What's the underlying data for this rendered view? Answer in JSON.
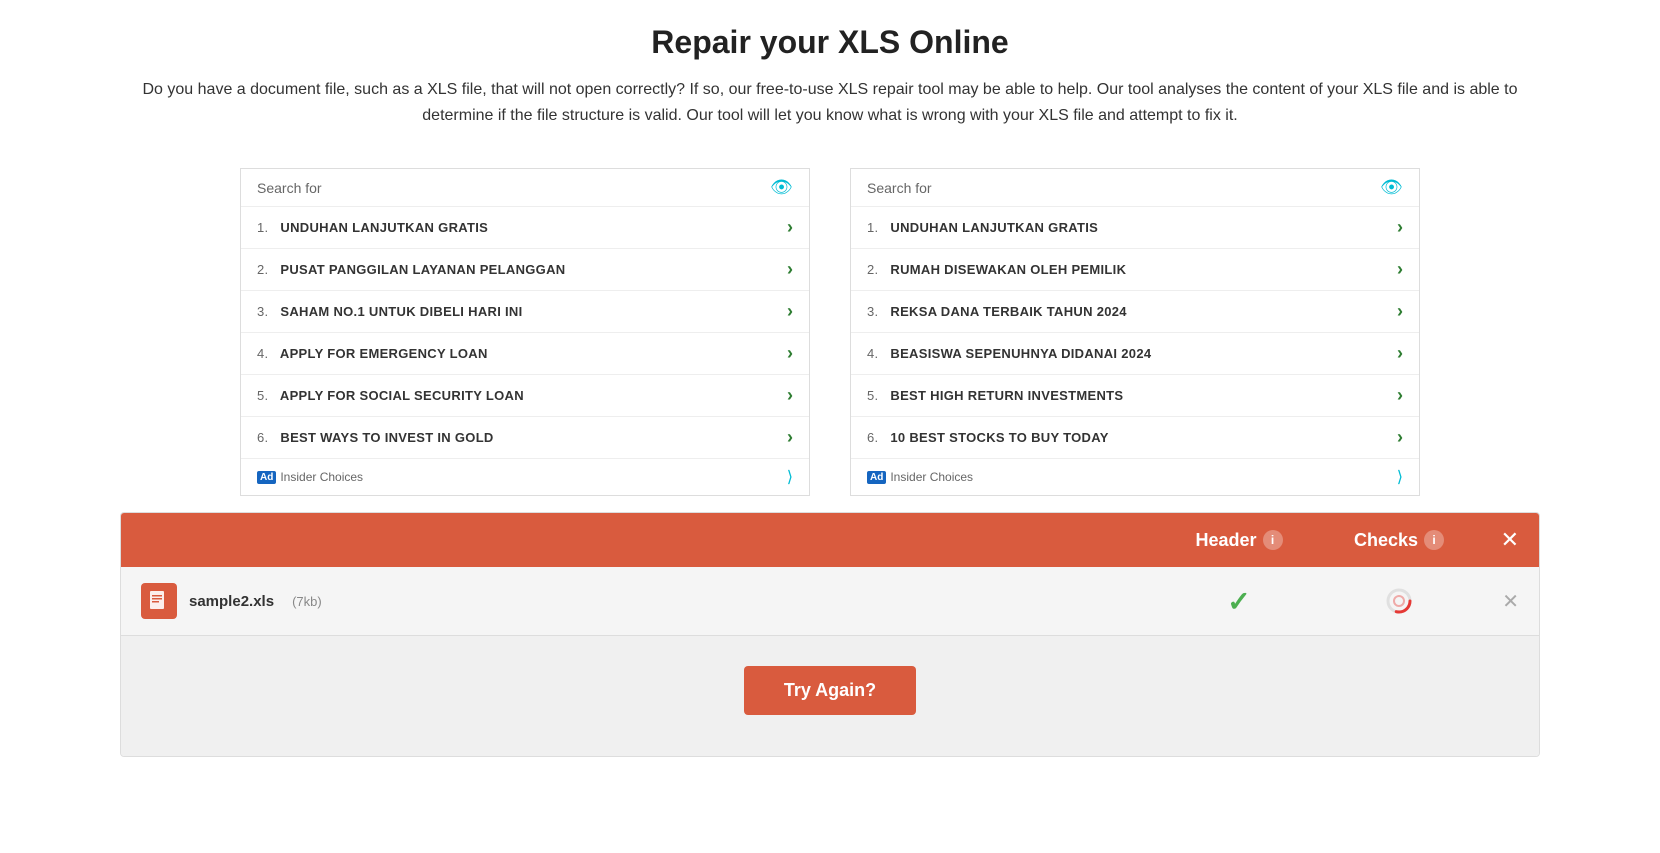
{
  "page": {
    "title": "Repair your XLS Online",
    "description": "Do you have a document file, such as a XLS file, that will not open correctly? If so, our free-to-use XLS repair tool may be able to help. Our tool analyses the content of your XLS file and is able to determine if the file structure is valid. Our tool will let you know what is wrong with your XLS file and attempt to fix it."
  },
  "left_panel": {
    "search_for": "Search for",
    "items": [
      {
        "num": "1.",
        "text": "UNDUHAN LANJUTKAN GRATIS"
      },
      {
        "num": "2.",
        "text": "PUSAT PANGGILAN LAYANAN PELANGGAN"
      },
      {
        "num": "3.",
        "text": "SAHAM NO.1 UNTUK DIBELI HARI INI"
      },
      {
        "num": "4.",
        "text": "APPLY FOR EMERGENCY LOAN"
      },
      {
        "num": "5.",
        "text": "APPLY FOR SOCIAL SECURITY LOAN"
      },
      {
        "num": "6.",
        "text": "BEST WAYS TO INVEST IN GOLD"
      }
    ],
    "footer_label": "Ad",
    "footer_text": "Insider Choices"
  },
  "right_panel": {
    "search_for": "Search for",
    "items": [
      {
        "num": "1.",
        "text": "UNDUHAN LANJUTKAN GRATIS"
      },
      {
        "num": "2.",
        "text": "RUMAH DISEWAKAN OLEH PEMILIK"
      },
      {
        "num": "3.",
        "text": "REKSA DANA TERBAIK TAHUN 2024"
      },
      {
        "num": "4.",
        "text": "BEASISWA SEPENUHNYA DIDANAI 2024"
      },
      {
        "num": "5.",
        "text": "BEST HIGH RETURN INVESTMENTS"
      },
      {
        "num": "6.",
        "text": "10 BEST STOCKS TO BUY TODAY"
      }
    ],
    "footer_label": "Ad",
    "footer_text": "Insider Choices"
  },
  "results_table": {
    "header_col1": "Header",
    "header_col2": "Checks",
    "file_name": "sample2.xls",
    "file_size": "(7kb)",
    "header_status": "check",
    "checks_status": "pending",
    "try_again_label": "Try Again?"
  }
}
